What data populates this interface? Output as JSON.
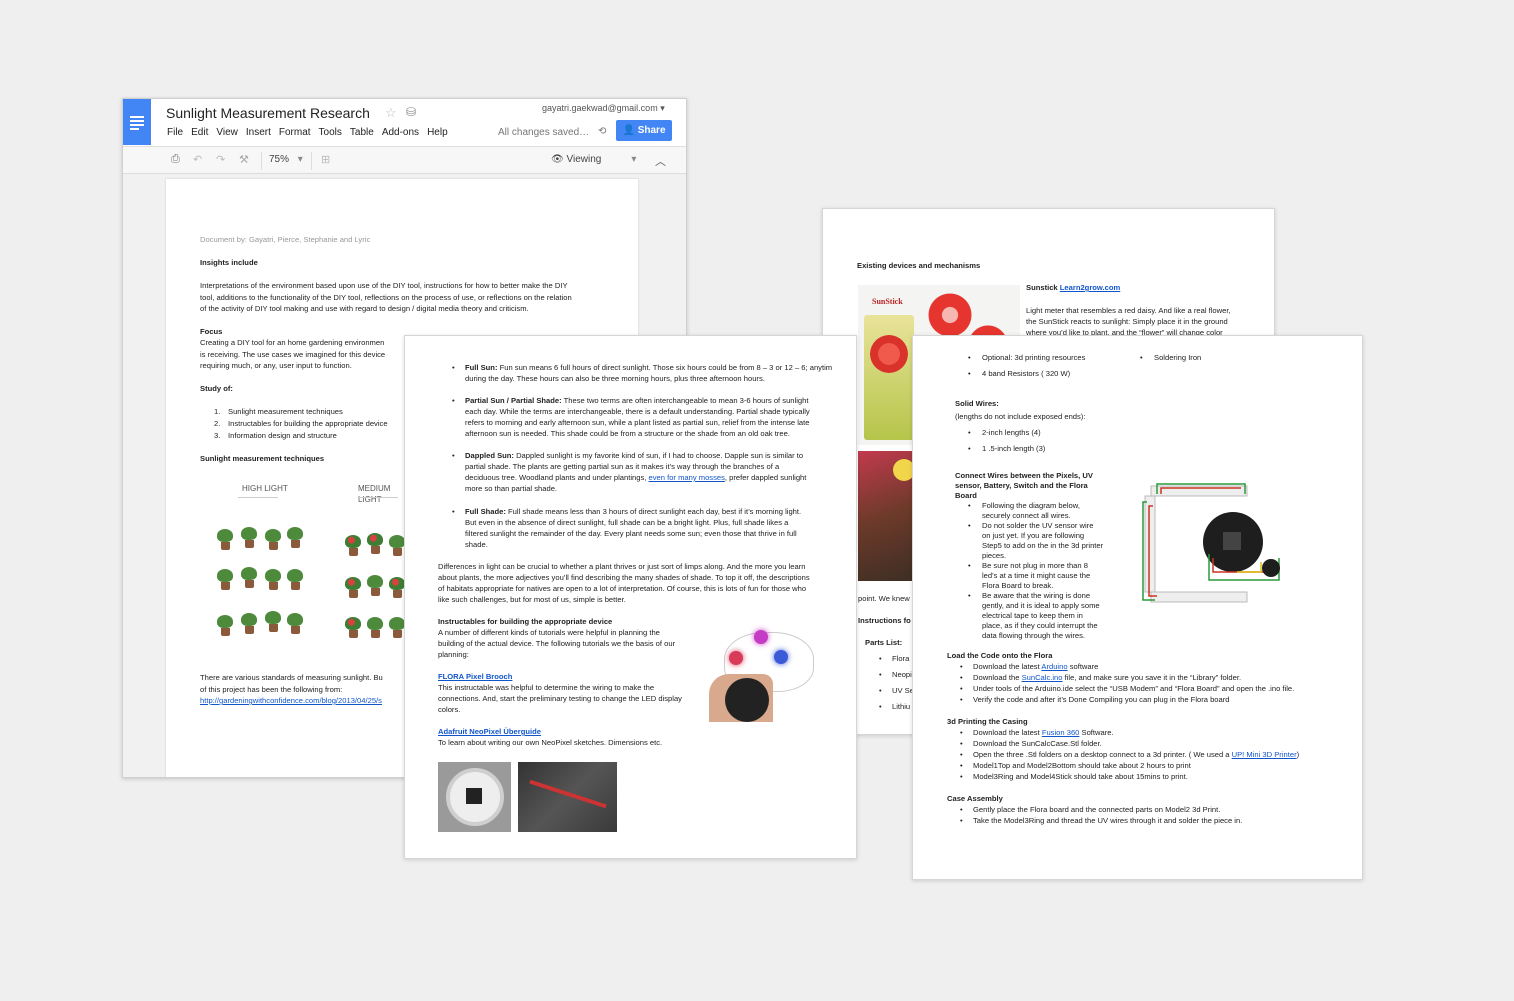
{
  "window": {
    "title": "Sunlight Measurement Research",
    "account": "gayatri.gaekwad@gmail.com",
    "menu": [
      "File",
      "Edit",
      "View",
      "Insert",
      "Format",
      "Tools",
      "Table",
      "Add-ons",
      "Help"
    ],
    "save_status": "All changes saved…",
    "share_label": "Share",
    "zoom": "75%",
    "mode": "Viewing"
  },
  "page1": {
    "byline": "Document by: Gayatri, Pierce, Stephanie and Lyric",
    "h_insights": "Insights include",
    "insights": [
      "Interpretations of the environment based upon use of the DIY tool, instructions for how to better make the DIY",
      "tool, additions to the functionality of the DIY tool, reflections on the process of use, or reflections on the relation",
      "of the activity of DIY tool making and use with regard to design / digital media theory and criticism."
    ],
    "h_focus": "Focus",
    "focus": [
      "Creating a DIY tool for an home gardening environmen",
      "is receiving. The use cases we imagined for this device",
      "requiring much, or any, user input to function."
    ],
    "h_study": "Study of:",
    "study": [
      "Sunlight measurement techniques",
      "Instructables for building the appropriate device",
      "Information design and structure"
    ],
    "h_tech": "Sunlight measurement techniques",
    "img_high": "HIGH LIGHT",
    "img_med": "MEDIUM LIGHT",
    "standards": [
      "There are various standards of measuring sunlight. Bu",
      "of this project has been the following from:"
    ],
    "link": "http://gardeningwithconfidence.com/blog/2013/04/25/s"
  },
  "page2": {
    "bullets": [
      {
        "term": "Full Sun:",
        "lines": [
          "Fun sun means 6 full hours of direct sunlight. Those six hours could be from 8 – 3 or 12 – 6; anytim",
          "during the day. These hours can also be three morning hours, plus three afternoon hours."
        ]
      },
      {
        "term": "Partial Sun / Partial Shade:",
        "lines": [
          "These two terms are often interchangeable to mean 3-6 hours of sunlight",
          "each day. While the terms are interchangeable, there is a default understanding.  Partial shade typically",
          "refers to morning and early afternoon sun, while a plant listed as partial sun, relief from the intense late",
          "afternoon sun is needed. This shade could be from a structure or the shade from an old oak tree."
        ]
      },
      {
        "term": "Dappled Sun:",
        "lines": [
          "Dappled sunlight is my favorite kind of sun, if I had to choose. Dapple sun is similar to",
          "partial shade. The plants are getting partial sun as it makes it’s way through the branches of a",
          "deciduous tree. Woodland plants and under plantings, ",
          "more so than partial shade."
        ],
        "link": "even for many mosses",
        "after": ", prefer dappled sunlight"
      },
      {
        "term": "Full Shade:",
        "lines": [
          " Full shade means less than 3 hours of direct sunlight each day, best if it’s morning light.",
          "But even in the absence of  direct sunlight, full shade can be a bright light. Plus, full shade likes a",
          "filtered  sunlight the remainder of the day. Every plant needs some sun; even those that thrive in full",
          "shade."
        ]
      }
    ],
    "para": [
      "Differences in light can be crucial to whether a plant thrives or just sort of limps along. And the more you learn",
      "about plants, the more adjectives you’ll find describing the many shades of shade. To top it off, the descriptions",
      "of habitats appropriate for natives are open to a lot of interpretation. Of course, this is lots of fun for those who",
      "like such challenges, but for most of us, simple is better."
    ],
    "h_instr": "Instructables for building the appropriate device",
    "instr": [
      "A number of different kinds of tutorials were helpful in planning the",
      "building of the actual device. The following tutorials we the basis of our",
      "planning:"
    ],
    "link1": "FLORA Pixel Brooch",
    "link1_desc": [
      "This instructable was helpful to determine the wiring to make the",
      "connections. And, start the preliminary testing to change the LED display",
      "colors."
    ],
    "link2": "Adafruit NeoPixel Überguide",
    "link2_desc": "To learn about writing our own NeoPixel sketches. Dimensions etc."
  },
  "page3": {
    "h": "Existing devices and mechanisms",
    "sunstick": "Sunstick",
    "sunstick_link": "Learn2grow.com",
    "desc": [
      "Light meter that resembles a red daisy. And like a real flower,",
      "the SunStick reacts to sunlight: Simply place it in the ground",
      "where you’d like to plant, and the “flower” will change color"
    ],
    "img_label": "SunStick",
    "frag1": "point. We knew",
    "frag2": "Instructions fo",
    "parts": "Parts List:",
    "parts_items": [
      "Flora",
      "Neopi",
      "UV Se",
      "Lithiu"
    ]
  },
  "page4": {
    "list_left": [
      "Optional: 3d printing resources",
      "4 band Resistors ( 320 W)"
    ],
    "list_right": "Soldering Iron",
    "h_solid": "Solid Wires:",
    "solid_note": "(lengths do not include exposed ends):",
    "solid": [
      "2-inch lengths (4)",
      "1 .5-inch length (3)"
    ],
    "h_connect": [
      "Connect Wires between the Pixels, UV",
      "sensor, Battery, Switch and the Flora",
      "Board"
    ],
    "connect": [
      [
        "Following the diagram below,",
        "securely connect all wires."
      ],
      [
        "Do not solder the UV sensor wire",
        "on just yet. If you are following",
        "Step5 to add on the in the 3d printer",
        "pieces."
      ],
      [
        "Be sure not plug in more than 8",
        "led's at a time it might cause the",
        "Flora Board to break."
      ],
      [
        "Be aware that the wiring is done",
        "gently, and it is ideal to apply some",
        "electrical tape to keep them in",
        "place, as if they could interrupt the",
        "data flowing through the wires."
      ]
    ],
    "h_load": "Load the Code onto the Flora",
    "load": [
      {
        "pre": "Download the latest ",
        "link": "Arduino",
        "post": " software"
      },
      {
        "pre": "Download the ",
        "link": "SunCalc.ino",
        "post": " file, and make sure you save it in the “Library” folder."
      },
      {
        "pre": "Under tools of the Arduino.ide select the “USB Modem” and “Flora Board” and open the .ino file.",
        "link": "",
        "post": ""
      },
      {
        "pre": "Verify the code and after it’s Done Compiling you can plug in the Flora board",
        "link": "",
        "post": ""
      }
    ],
    "h_print": "3d Printing the Casing",
    "print": [
      {
        "pre": "Download the latest ",
        "link": "Fusion 360",
        "post": " Software."
      },
      {
        "pre": "Download the SunCalcCase.Stl folder.",
        "link": "",
        "post": ""
      },
      {
        "pre": "Open the three .Stl folders on a desktop connect to a 3d printer. ( We used a ",
        "link": "UP! Mini 3D Printer",
        "post": ")"
      },
      {
        "pre": "Model1Top and Model2Bottom should take about 2 hours to print",
        "link": "",
        "post": ""
      },
      {
        "pre": "Model3Ring and Model4Stick should take about 15mins to print.",
        "link": "",
        "post": ""
      }
    ],
    "h_case": "Case Assembly",
    "case": [
      "Gently place the Flora board and the connected parts on Model2 3d Print.",
      "Take the Model3Ring and thread the UV wires through it and solder the piece in."
    ]
  }
}
